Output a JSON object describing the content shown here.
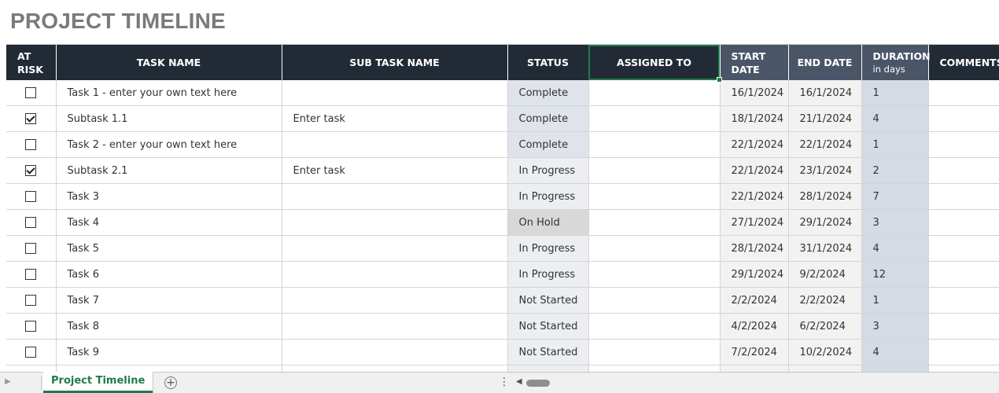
{
  "page": {
    "title": "PROJECT TIMELINE"
  },
  "columns": {
    "at_risk": [
      "AT",
      "RISK"
    ],
    "task_name": "TASK NAME",
    "sub_task_name": "SUB TASK NAME",
    "status": "STATUS",
    "assigned_to": "ASSIGNED TO",
    "start_date": [
      "START",
      "DATE"
    ],
    "end_date": "END DATE",
    "duration": "DURATION",
    "duration_unit": "in days",
    "comments": "COMMENTS"
  },
  "rows": [
    {
      "at_risk": false,
      "task": "Task 1 - enter your own text here",
      "subtask": "",
      "status": "Complete",
      "assigned": "",
      "start": "16/1/2024",
      "end": "16/1/2024",
      "duration": "1",
      "comments": ""
    },
    {
      "at_risk": true,
      "task": "Subtask 1.1",
      "subtask": "Enter task",
      "status": "Complete",
      "assigned": "",
      "start": "18/1/2024",
      "end": "21/1/2024",
      "duration": "4",
      "comments": ""
    },
    {
      "at_risk": false,
      "task": "Task 2 - enter your own text here",
      "subtask": "",
      "status": "Complete",
      "assigned": "",
      "start": "22/1/2024",
      "end": "22/1/2024",
      "duration": "1",
      "comments": ""
    },
    {
      "at_risk": true,
      "task": "Subtask 2.1",
      "subtask": "Enter task",
      "status": "In Progress",
      "assigned": "",
      "start": "22/1/2024",
      "end": "23/1/2024",
      "duration": "2",
      "comments": ""
    },
    {
      "at_risk": false,
      "task": "Task 3",
      "subtask": "",
      "status": "In Progress",
      "assigned": "",
      "start": "22/1/2024",
      "end": "28/1/2024",
      "duration": "7",
      "comments": ""
    },
    {
      "at_risk": false,
      "task": "Task 4",
      "subtask": "",
      "status": "On Hold",
      "assigned": "",
      "start": "27/1/2024",
      "end": "29/1/2024",
      "duration": "3",
      "comments": ""
    },
    {
      "at_risk": false,
      "task": "Task 5",
      "subtask": "",
      "status": "In Progress",
      "assigned": "",
      "start": "28/1/2024",
      "end": "31/1/2024",
      "duration": "4",
      "comments": ""
    },
    {
      "at_risk": false,
      "task": "Task 6",
      "subtask": "",
      "status": "In Progress",
      "assigned": "",
      "start": "29/1/2024",
      "end": "9/2/2024",
      "duration": "12",
      "comments": ""
    },
    {
      "at_risk": false,
      "task": "Task 7",
      "subtask": "",
      "status": "Not Started",
      "assigned": "",
      "start": "2/2/2024",
      "end": "2/2/2024",
      "duration": "1",
      "comments": ""
    },
    {
      "at_risk": false,
      "task": "Task 8",
      "subtask": "",
      "status": "Not Started",
      "assigned": "",
      "start": "4/2/2024",
      "end": "6/2/2024",
      "duration": "3",
      "comments": ""
    },
    {
      "at_risk": false,
      "task": "Task 9",
      "subtask": "",
      "status": "Not Started",
      "assigned": "",
      "start": "7/2/2024",
      "end": "10/2/2024",
      "duration": "4",
      "comments": ""
    },
    {
      "at_risk": false,
      "task": "",
      "subtask": "",
      "status": "",
      "assigned": "",
      "start": "",
      "end": "",
      "duration": "",
      "comments": ""
    }
  ],
  "sheet_tabs": {
    "active": "Project Timeline",
    "add_icon": "plus-circle-icon"
  },
  "colors": {
    "header_dark": "#222b35",
    "header_slate": "#4a5668",
    "accent": "#1f7a4a",
    "title": "#7a7a7a"
  }
}
